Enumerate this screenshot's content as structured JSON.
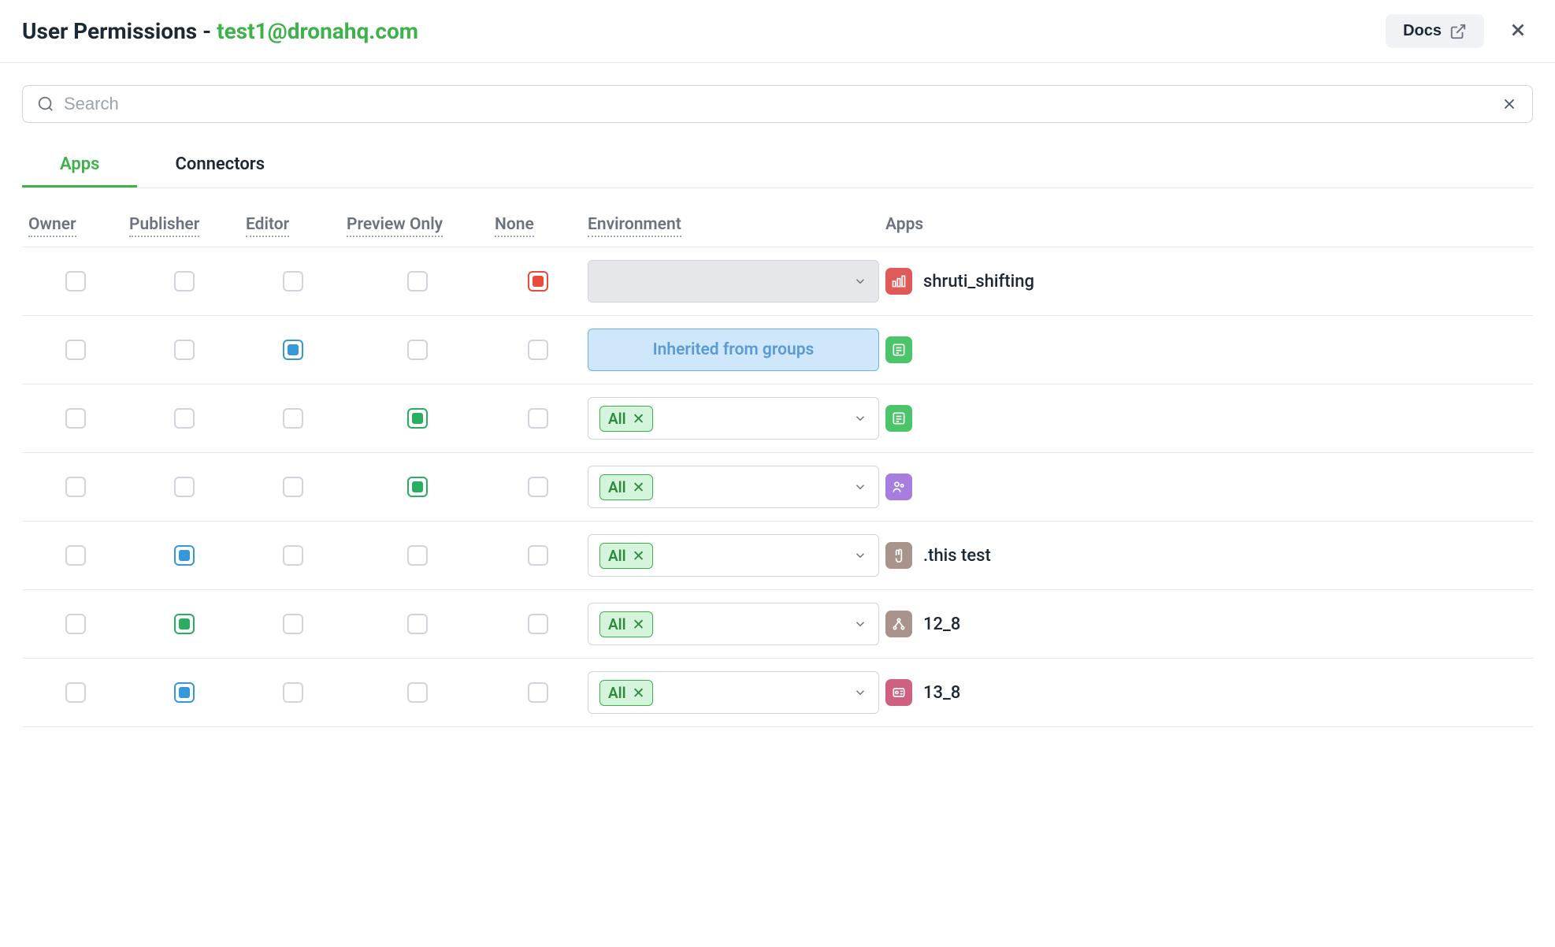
{
  "header": {
    "title_prefix": "User Permissions - ",
    "email": "test1@dronahq.com",
    "docs_label": "Docs"
  },
  "search": {
    "placeholder": "Search"
  },
  "tabs": [
    {
      "label": "Apps",
      "active": true
    },
    {
      "label": "Connectors",
      "active": false
    }
  ],
  "columns": {
    "owner": "Owner",
    "publisher": "Publisher",
    "editor": "Editor",
    "preview": "Preview Only",
    "none": "None",
    "environment": "Environment",
    "apps": "Apps"
  },
  "env": {
    "inherited_label": "Inherited from groups",
    "all_tag": "All"
  },
  "rows": [
    {
      "owner": "",
      "publisher": "",
      "editor": "",
      "preview": "",
      "none": "red",
      "env_type": "disabled",
      "icon": "red-chart",
      "app_name": "shruti_shifting"
    },
    {
      "owner": "",
      "publisher": "",
      "editor": "blue",
      "preview": "",
      "none": "",
      "env_type": "inherited",
      "icon": "green-news",
      "app_name": ""
    },
    {
      "owner": "",
      "publisher": "",
      "editor": "",
      "preview": "green",
      "none": "",
      "env_type": "all",
      "icon": "green-news",
      "app_name": ""
    },
    {
      "owner": "",
      "publisher": "",
      "editor": "",
      "preview": "green",
      "none": "",
      "env_type": "all",
      "icon": "purple-people",
      "app_name": ""
    },
    {
      "owner": "",
      "publisher": "blue",
      "editor": "",
      "preview": "",
      "none": "",
      "env_type": "all",
      "icon": "brown-hand",
      "app_name": ".this test"
    },
    {
      "owner": "",
      "publisher": "green",
      "editor": "",
      "preview": "",
      "none": "",
      "env_type": "all",
      "icon": "brown-network",
      "app_name": "12_8"
    },
    {
      "owner": "",
      "publisher": "blue",
      "editor": "",
      "preview": "",
      "none": "",
      "env_type": "all",
      "icon": "pink-card",
      "app_name": "13_8"
    }
  ]
}
